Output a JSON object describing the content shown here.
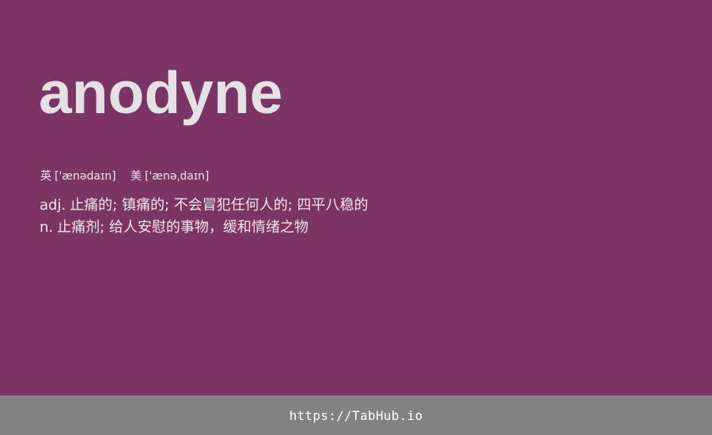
{
  "entry": {
    "word": "anodyne",
    "phonetics": [
      {
        "label": "英",
        "ipa": "['ænədaɪn]"
      },
      {
        "label": "美",
        "ipa": "['ænəˌdaɪn]"
      }
    ],
    "definitions": [
      {
        "pos": "adj.",
        "meaning": "止痛的; 镇痛的; 不会冒犯任何人的; 四平八稳的"
      },
      {
        "pos": "n.",
        "meaning": "止痛剂; 给人安慰的事物，缓和情绪之物"
      }
    ]
  },
  "footer": {
    "link_text": "https://TabHub.io"
  },
  "colors": {
    "background": "#7b3565",
    "footer_background": "#828282",
    "word_text": "#e4e1e4",
    "body_text": "#ece6ea"
  }
}
